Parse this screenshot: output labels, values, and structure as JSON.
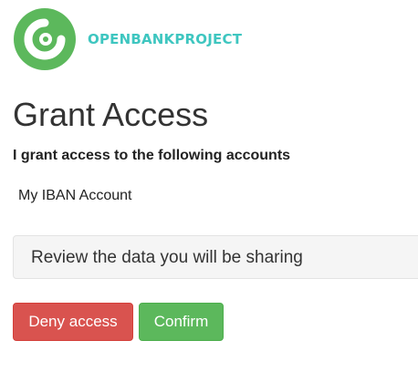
{
  "brand": {
    "name": "OPENBANKPROJECT",
    "logo_icon": "open-bank-project-logo-icon",
    "colors": {
      "logo_green": "#5cb85c",
      "wordmark_teal": "#3ec6c0"
    }
  },
  "page": {
    "title": "Grant Access",
    "subtitle": "I grant access to the following accounts"
  },
  "accounts": [
    {
      "label": "My IBAN Account"
    }
  ],
  "review_panel": {
    "label": "Review the data you will be sharing"
  },
  "actions": {
    "deny_label": "Deny access",
    "confirm_label": "Confirm",
    "colors": {
      "deny": "#d9534f",
      "confirm": "#5cb85c"
    }
  }
}
